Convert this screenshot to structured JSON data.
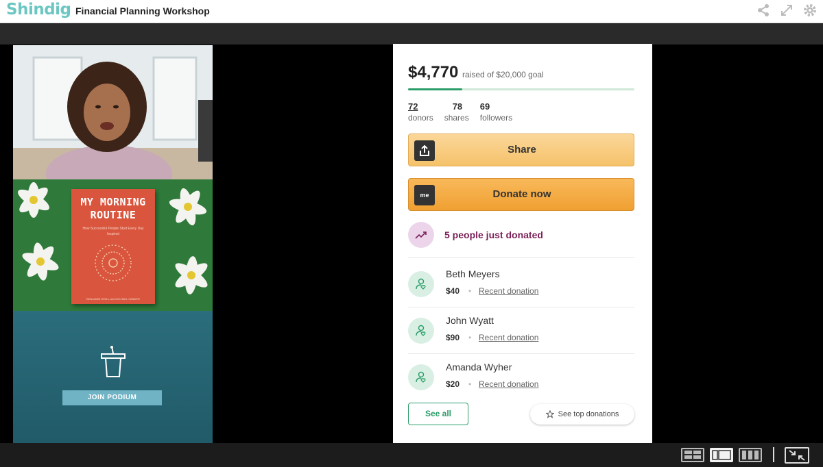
{
  "header": {
    "logo": "Shindig",
    "title": "Financial Planning Workshop",
    "icons": [
      "share-icon",
      "fullscreen-icon",
      "gear-icon"
    ]
  },
  "left_panel": {
    "book": {
      "title_line1": "MY MORNING",
      "title_line2": "ROUTINE",
      "subtitle": "How Successful People Start Every Day Inspired",
      "authors": "BENJAMIN SPALL and MICHAEL XANDER"
    },
    "podium": {
      "button_label": "JOIN PODIUM",
      "icon": "podium-icon"
    }
  },
  "donation": {
    "amount": "$4,770",
    "goal_text": "raised of $20,000 goal",
    "progress": 0.2385,
    "stats": [
      {
        "value": "72",
        "label": "donors"
      },
      {
        "value": "78",
        "label": "shares"
      },
      {
        "value": "69",
        "label": "followers"
      }
    ],
    "share_label": "Share",
    "donate_label": "Donate now",
    "donate_icon_text": "me",
    "just_donated": "5 people just donated",
    "donors": [
      {
        "name": "Beth Meyers",
        "amount": "$40",
        "link": "Recent donation"
      },
      {
        "name": "John Wyatt",
        "amount": "$90",
        "link": "Recent donation"
      },
      {
        "name": "Amanda Wyher",
        "amount": "$20",
        "link": "Recent donation"
      }
    ],
    "see_all_label": "See all",
    "see_top_label": "See top donations"
  },
  "colors": {
    "brand": "#6cc7c2",
    "progress": "#2a9d68",
    "share_button": "#f5c26a",
    "donate_button": "#f0a032",
    "trend_text": "#7a1f57"
  }
}
